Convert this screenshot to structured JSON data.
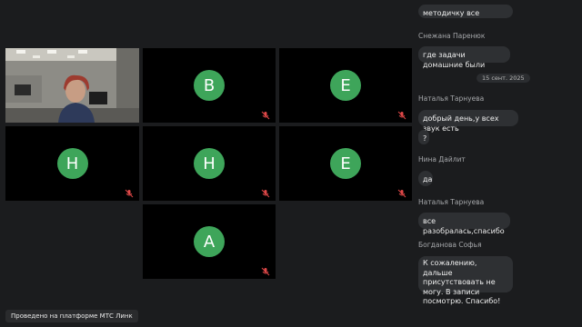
{
  "participants": [
    {
      "id": "video",
      "initial": "",
      "has_video": true,
      "mic": "muted"
    },
    {
      "id": "b1",
      "initial": "В",
      "mic": "muted"
    },
    {
      "id": "e1",
      "initial": "Е",
      "mic": "muted"
    },
    {
      "id": "n1",
      "initial": "Н",
      "mic": "muted"
    },
    {
      "id": "n2",
      "initial": "Н",
      "mic": "muted"
    },
    {
      "id": "e2",
      "initial": "Е",
      "mic": "muted"
    },
    {
      "id": "a1",
      "initial": "А",
      "mic": "muted"
    }
  ],
  "avatar_color": "#3ea55a",
  "chat": {
    "top_partial": "методичку все смотрят!?",
    "msg1_sender": "Снежана Паренюк",
    "msg1_text": "где задачи домашние были",
    "date_chip": "15 сент. 2025",
    "msg2_sender": "Наталья Тарнуева",
    "msg2_text": "добрый день,у всех звук есть",
    "msg2b_text": "?",
    "msg3_sender": "Нина Дайлит",
    "msg3_text": "да",
    "msg4_sender": "Наталья Тарнуева",
    "msg4_text": "все разобралась,спасибо",
    "msg5_sender": "Богданова Софья",
    "msg5_text": "К сожалению, дальше присутствовать не могу. В записи посмотрю. Спасибо!"
  },
  "footer": "Проведено на платформе МТС Линк",
  "icons": {
    "mic_off": "mic-off-icon"
  }
}
